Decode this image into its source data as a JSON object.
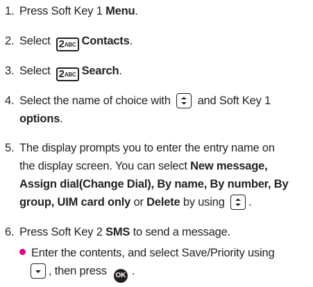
{
  "steps": [
    {
      "num": "1.",
      "pre": "Press  Soft Key 1 ",
      "bold": "Menu",
      "post": "."
    },
    {
      "num": "2.",
      "pre": "Select",
      "key": "2",
      "key_sub": "ABC",
      "bold": "Contacts",
      "post": "."
    },
    {
      "num": "3.",
      "pre": "Select",
      "key": "2",
      "key_sub": "ABC",
      "bold": "Search",
      "post": "."
    },
    {
      "num": "4.",
      "pre": "Select the name of choice with",
      "mid": "and Soft Key 1",
      "bold": "options",
      "post": "."
    },
    {
      "num": "5.",
      "line1": "The display prompts you to enter the entry name on",
      "line2_pre": "the display screen. You can select ",
      "opt_new": "New message,",
      "opt_assign": "Assign dial(Change Dial)",
      "sep1": ", ",
      "opt_name": "By name",
      "sep2": ", ",
      "opt_number": "By number",
      "sep3": ", ",
      "opt_by": "By",
      "opt_group": "group",
      "sep4": ", ",
      "opt_uim": "UIM card only",
      "or": " or ",
      "opt_delete": "Delete",
      "by_using": " by using",
      "post": "."
    },
    {
      "num": "6.",
      "pre": "Press Soft Key 2 ",
      "bold": "SMS",
      "post": " to send a message."
    }
  ],
  "bullet": {
    "line1": "Enter the contents, and select Save/Priority using",
    "line2_pre": ", then press",
    "ok_label": "OK",
    "post": "."
  },
  "colors": {
    "bullet": "#e4007f",
    "text": "#231f20"
  }
}
